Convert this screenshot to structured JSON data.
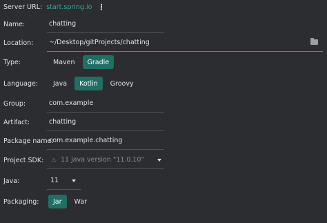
{
  "server": {
    "label": "Server URL:",
    "url": "start.spring.io",
    "menu_icon": "kebab-menu-icon"
  },
  "name": {
    "label": "Name:",
    "value": "chatting"
  },
  "location": {
    "label": "Location:",
    "value": "~/Desktop/gitProjects/chatting",
    "icon": "folder-icon"
  },
  "type": {
    "label": "Type:",
    "options": [
      "Maven",
      "Gradle"
    ],
    "selected": "Gradle"
  },
  "language": {
    "label": "Language:",
    "options": [
      "Java",
      "Kotlin",
      "Groovy"
    ],
    "selected": "Kotlin"
  },
  "group": {
    "label": "Group:",
    "value": "com.example"
  },
  "artifact": {
    "label": "Artifact:",
    "value": "chatting"
  },
  "package_name": {
    "label": "Package name:",
    "value": "com.example.chatting"
  },
  "sdk": {
    "label": "Project SDK:",
    "value": "11 java version \"11.0.10\"",
    "icon": "java-sdk-icon"
  },
  "java": {
    "label": "Java:",
    "value": "11"
  },
  "packaging": {
    "label": "Packaging:",
    "options": [
      "Jar",
      "War"
    ],
    "selected": "Jar"
  },
  "colors": {
    "accent": "#2f9c8f",
    "selected_bg": "#1f6f63",
    "link": "#35a89b",
    "background": "#2b2d30"
  }
}
